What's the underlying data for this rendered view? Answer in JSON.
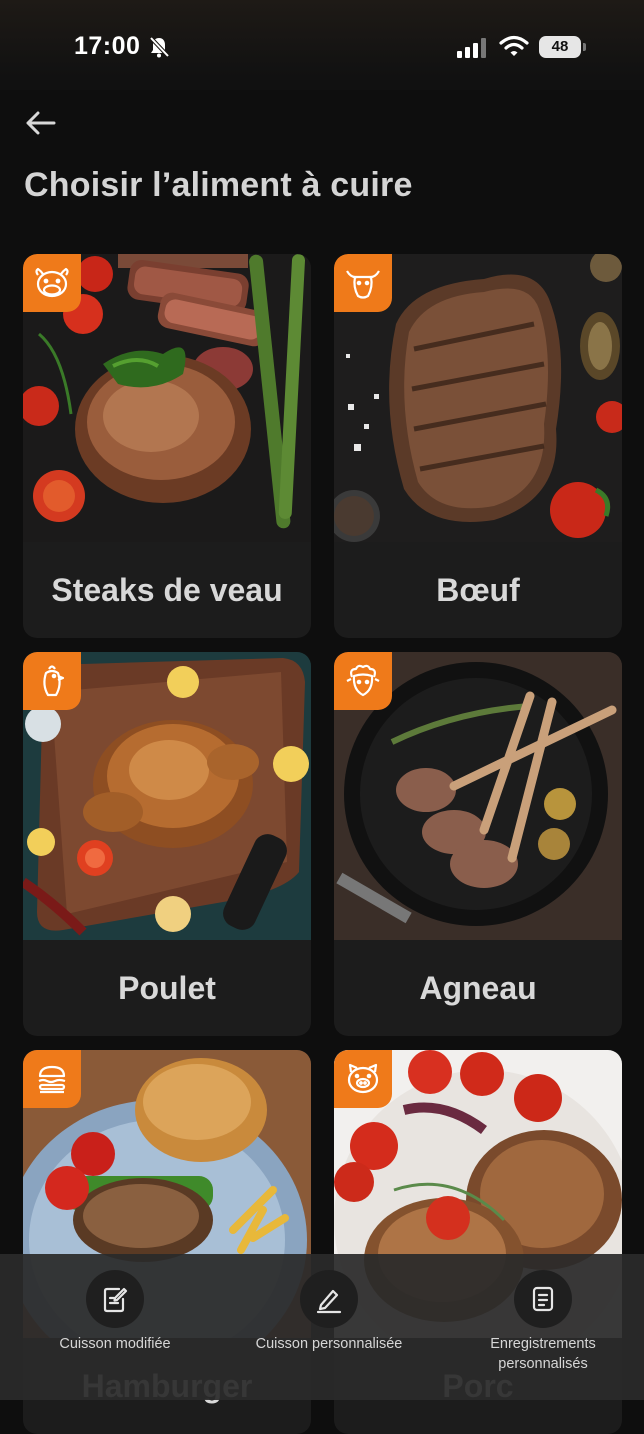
{
  "status_bar": {
    "time": "17:00",
    "battery": "48"
  },
  "header": {
    "title": "Choisir l’aliment à cuire"
  },
  "foods": [
    {
      "label": "Steaks de veau",
      "badge_icon": "cow-icon"
    },
    {
      "label": "Bœuf",
      "badge_icon": "bull-icon"
    },
    {
      "label": "Poulet",
      "badge_icon": "chicken-icon"
    },
    {
      "label": "Agneau",
      "badge_icon": "sheep-icon"
    },
    {
      "label": "Hamburger",
      "badge_icon": "burger-icon"
    },
    {
      "label": "Porc",
      "badge_icon": "pig-icon"
    }
  ],
  "bottom_bar": [
    {
      "label": "Cuisson modifiée",
      "icon": "edit-document-icon"
    },
    {
      "label": "Cuisson personnalisée",
      "icon": "pencil-icon"
    },
    {
      "label": "Enregistrements personnalisés",
      "icon": "records-icon"
    }
  ],
  "colors": {
    "background": "#0e0e0e",
    "card": "#1c1c1c",
    "accent": "#ef7a1a",
    "bottom_bar": "#2a2a2a"
  }
}
